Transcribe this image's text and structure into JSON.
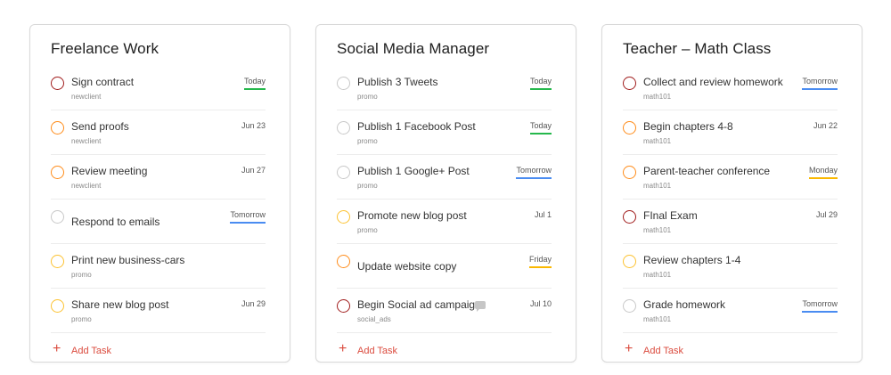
{
  "colors": {
    "today": "#25b84c",
    "tomorrow": "#4a8cf1",
    "weekday": "#fab800",
    "priority1": "#b8255f",
    "priority2": "#ff8c1a",
    "priority3": "#fcc231",
    "none": "#c8c8c8",
    "red_circle": "#a01c1c",
    "accent": "#db4c3f"
  },
  "projects": [
    {
      "title": "Freelance Work",
      "add_label": "Add Task",
      "tasks": [
        {
          "name": "Sign contract",
          "project": "newclient",
          "date": "Today",
          "date_style": "today",
          "priority": "red"
        },
        {
          "name": "Send proofs",
          "project": "newclient",
          "date": "Jun 23",
          "date_style": "plain",
          "priority": "orange"
        },
        {
          "name": "Review meeting",
          "project": "newclient",
          "date": "Jun 27",
          "date_style": "plain",
          "priority": "orange"
        },
        {
          "name": "Respond to emails",
          "project": "",
          "date": "Tomorrow",
          "date_style": "tomorrow",
          "priority": "none"
        },
        {
          "name": "Print new business-cars",
          "project": "promo",
          "date": "",
          "date_style": "plain",
          "priority": "yellow"
        },
        {
          "name": "Share new blog post",
          "project": "promo",
          "date": "Jun 29",
          "date_style": "plain",
          "priority": "yellow"
        }
      ]
    },
    {
      "title": "Social Media Manager",
      "add_label": "Add Task",
      "tasks": [
        {
          "name": "Publish 3 Tweets",
          "project": "promo",
          "date": "Today",
          "date_style": "today",
          "priority": "none"
        },
        {
          "name": "Publish 1 Facebook Post",
          "project": "promo",
          "date": "Today",
          "date_style": "today",
          "priority": "none"
        },
        {
          "name": "Publish 1 Google+ Post",
          "project": "promo",
          "date": "Tomorrow",
          "date_style": "tomorrow",
          "priority": "none"
        },
        {
          "name": "Promote new blog post",
          "project": "promo",
          "date": "Jul 1",
          "date_style": "plain",
          "priority": "yellow"
        },
        {
          "name": "Update website copy",
          "project": "",
          "date": "Friday",
          "date_style": "weekday",
          "priority": "orange"
        },
        {
          "name": "Begin Social ad campaign",
          "project": "social_ads",
          "date": "Jul 10",
          "date_style": "plain",
          "priority": "red",
          "comment": true
        }
      ]
    },
    {
      "title": "Teacher – Math Class",
      "add_label": "Add Task",
      "tasks": [
        {
          "name": "Collect and review homework",
          "project": "math101",
          "date": "Tomorrow",
          "date_style": "tomorrow",
          "priority": "red"
        },
        {
          "name": "Begin chapters 4-8",
          "project": "math101",
          "date": "Jun 22",
          "date_style": "plain",
          "priority": "orange"
        },
        {
          "name": "Parent-teacher conference",
          "project": "math101",
          "date": "Monday",
          "date_style": "weekday",
          "priority": "orange"
        },
        {
          "name": "FInal Exam",
          "project": "math101",
          "date": "Jul 29",
          "date_style": "plain",
          "priority": "red"
        },
        {
          "name": "Review chapters 1-4",
          "project": "math101",
          "date": "",
          "date_style": "plain",
          "priority": "yellow"
        },
        {
          "name": "Grade homework",
          "project": "math101",
          "date": "Tomorrow",
          "date_style": "tomorrow",
          "priority": "none"
        }
      ]
    }
  ]
}
